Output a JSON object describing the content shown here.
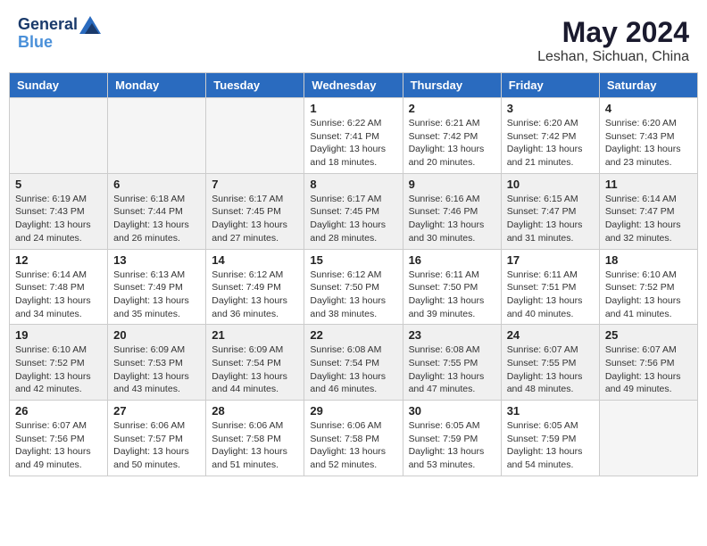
{
  "header": {
    "logo_line1": "General",
    "logo_line2": "Blue",
    "title": "May 2024",
    "subtitle": "Leshan, Sichuan, China"
  },
  "weekdays": [
    "Sunday",
    "Monday",
    "Tuesday",
    "Wednesday",
    "Thursday",
    "Friday",
    "Saturday"
  ],
  "weeks": [
    [
      {
        "day": "",
        "info": ""
      },
      {
        "day": "",
        "info": ""
      },
      {
        "day": "",
        "info": ""
      },
      {
        "day": "1",
        "info": "Sunrise: 6:22 AM\nSunset: 7:41 PM\nDaylight: 13 hours\nand 18 minutes."
      },
      {
        "day": "2",
        "info": "Sunrise: 6:21 AM\nSunset: 7:42 PM\nDaylight: 13 hours\nand 20 minutes."
      },
      {
        "day": "3",
        "info": "Sunrise: 6:20 AM\nSunset: 7:42 PM\nDaylight: 13 hours\nand 21 minutes."
      },
      {
        "day": "4",
        "info": "Sunrise: 6:20 AM\nSunset: 7:43 PM\nDaylight: 13 hours\nand 23 minutes."
      }
    ],
    [
      {
        "day": "5",
        "info": "Sunrise: 6:19 AM\nSunset: 7:43 PM\nDaylight: 13 hours\nand 24 minutes."
      },
      {
        "day": "6",
        "info": "Sunrise: 6:18 AM\nSunset: 7:44 PM\nDaylight: 13 hours\nand 26 minutes."
      },
      {
        "day": "7",
        "info": "Sunrise: 6:17 AM\nSunset: 7:45 PM\nDaylight: 13 hours\nand 27 minutes."
      },
      {
        "day": "8",
        "info": "Sunrise: 6:17 AM\nSunset: 7:45 PM\nDaylight: 13 hours\nand 28 minutes."
      },
      {
        "day": "9",
        "info": "Sunrise: 6:16 AM\nSunset: 7:46 PM\nDaylight: 13 hours\nand 30 minutes."
      },
      {
        "day": "10",
        "info": "Sunrise: 6:15 AM\nSunset: 7:47 PM\nDaylight: 13 hours\nand 31 minutes."
      },
      {
        "day": "11",
        "info": "Sunrise: 6:14 AM\nSunset: 7:47 PM\nDaylight: 13 hours\nand 32 minutes."
      }
    ],
    [
      {
        "day": "12",
        "info": "Sunrise: 6:14 AM\nSunset: 7:48 PM\nDaylight: 13 hours\nand 34 minutes."
      },
      {
        "day": "13",
        "info": "Sunrise: 6:13 AM\nSunset: 7:49 PM\nDaylight: 13 hours\nand 35 minutes."
      },
      {
        "day": "14",
        "info": "Sunrise: 6:12 AM\nSunset: 7:49 PM\nDaylight: 13 hours\nand 36 minutes."
      },
      {
        "day": "15",
        "info": "Sunrise: 6:12 AM\nSunset: 7:50 PM\nDaylight: 13 hours\nand 38 minutes."
      },
      {
        "day": "16",
        "info": "Sunrise: 6:11 AM\nSunset: 7:50 PM\nDaylight: 13 hours\nand 39 minutes."
      },
      {
        "day": "17",
        "info": "Sunrise: 6:11 AM\nSunset: 7:51 PM\nDaylight: 13 hours\nand 40 minutes."
      },
      {
        "day": "18",
        "info": "Sunrise: 6:10 AM\nSunset: 7:52 PM\nDaylight: 13 hours\nand 41 minutes."
      }
    ],
    [
      {
        "day": "19",
        "info": "Sunrise: 6:10 AM\nSunset: 7:52 PM\nDaylight: 13 hours\nand 42 minutes."
      },
      {
        "day": "20",
        "info": "Sunrise: 6:09 AM\nSunset: 7:53 PM\nDaylight: 13 hours\nand 43 minutes."
      },
      {
        "day": "21",
        "info": "Sunrise: 6:09 AM\nSunset: 7:54 PM\nDaylight: 13 hours\nand 44 minutes."
      },
      {
        "day": "22",
        "info": "Sunrise: 6:08 AM\nSunset: 7:54 PM\nDaylight: 13 hours\nand 46 minutes."
      },
      {
        "day": "23",
        "info": "Sunrise: 6:08 AM\nSunset: 7:55 PM\nDaylight: 13 hours\nand 47 minutes."
      },
      {
        "day": "24",
        "info": "Sunrise: 6:07 AM\nSunset: 7:55 PM\nDaylight: 13 hours\nand 48 minutes."
      },
      {
        "day": "25",
        "info": "Sunrise: 6:07 AM\nSunset: 7:56 PM\nDaylight: 13 hours\nand 49 minutes."
      }
    ],
    [
      {
        "day": "26",
        "info": "Sunrise: 6:07 AM\nSunset: 7:56 PM\nDaylight: 13 hours\nand 49 minutes."
      },
      {
        "day": "27",
        "info": "Sunrise: 6:06 AM\nSunset: 7:57 PM\nDaylight: 13 hours\nand 50 minutes."
      },
      {
        "day": "28",
        "info": "Sunrise: 6:06 AM\nSunset: 7:58 PM\nDaylight: 13 hours\nand 51 minutes."
      },
      {
        "day": "29",
        "info": "Sunrise: 6:06 AM\nSunset: 7:58 PM\nDaylight: 13 hours\nand 52 minutes."
      },
      {
        "day": "30",
        "info": "Sunrise: 6:05 AM\nSunset: 7:59 PM\nDaylight: 13 hours\nand 53 minutes."
      },
      {
        "day": "31",
        "info": "Sunrise: 6:05 AM\nSunset: 7:59 PM\nDaylight: 13 hours\nand 54 minutes."
      },
      {
        "day": "",
        "info": ""
      }
    ]
  ]
}
